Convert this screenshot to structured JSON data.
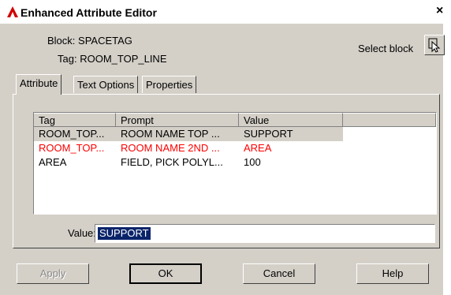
{
  "window": {
    "title": "Enhanced Attribute Editor",
    "close": "×"
  },
  "info": {
    "block_label": "Block:",
    "block_value": "SPACETAG",
    "tag_label": "Tag:",
    "tag_value": "ROOM_TOP_LINE"
  },
  "select_block": {
    "label": "Select block"
  },
  "tabs": [
    {
      "label": "Attribute"
    },
    {
      "label": "Text Options"
    },
    {
      "label": "Properties"
    }
  ],
  "table": {
    "headers": [
      "Tag",
      "Prompt",
      "Value"
    ],
    "rows": [
      {
        "tag": "ROOM_TOP...",
        "prompt": "ROOM NAME TOP ...",
        "value": "SUPPORT",
        "color": "#000000"
      },
      {
        "tag": "ROOM_TOP...",
        "prompt": "ROOM NAME 2ND ...",
        "value": "AREA",
        "color": "#ff0000"
      },
      {
        "tag": "AREA",
        "prompt": "FIELD, PICK POLYL...",
        "value": "100",
        "color": "#000000"
      }
    ]
  },
  "value_field": {
    "label": "Value:",
    "value": "SUPPORT"
  },
  "buttons": {
    "apply": "Apply",
    "ok": "OK",
    "cancel": "Cancel",
    "help": "Help"
  }
}
